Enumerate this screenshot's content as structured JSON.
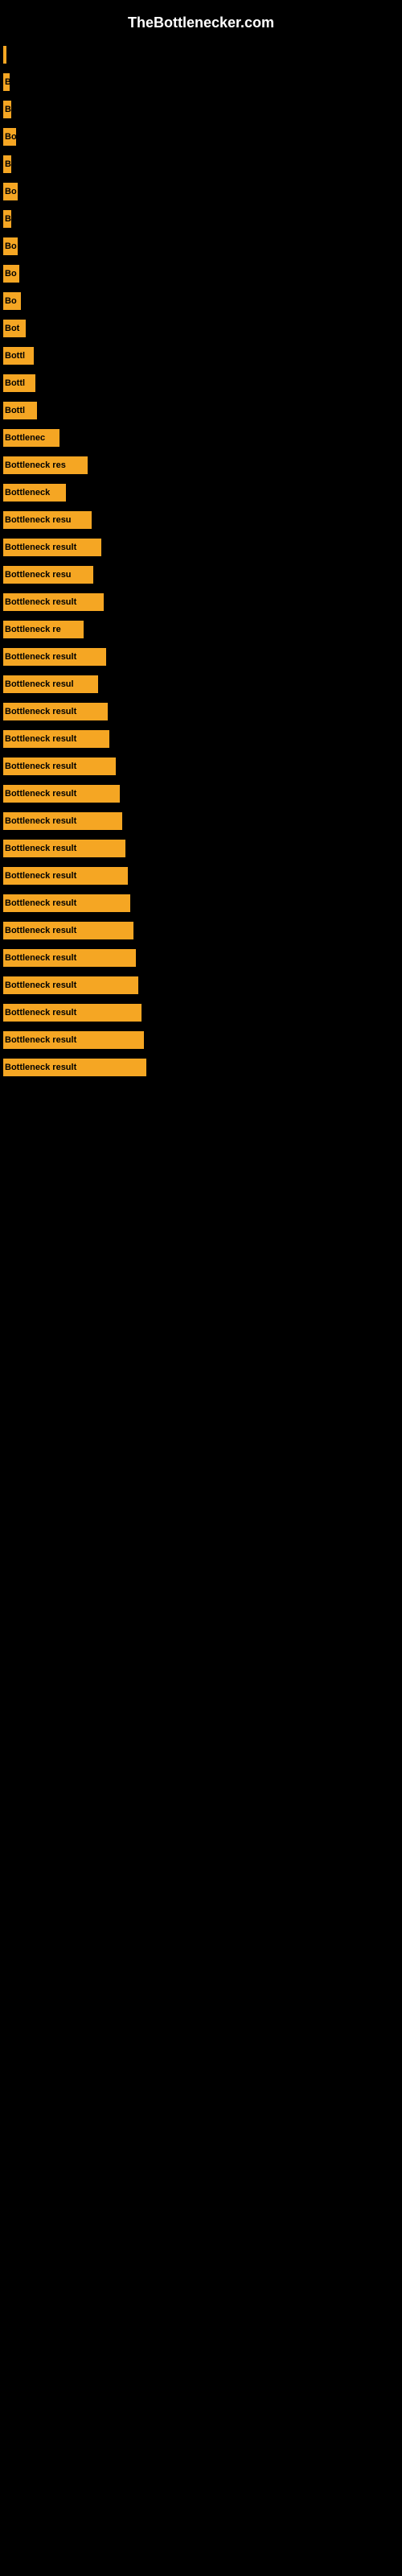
{
  "site_title": "TheBottlenecker.com",
  "bars": [
    {
      "label": "",
      "width": 4
    },
    {
      "label": "B",
      "width": 8
    },
    {
      "label": "B",
      "width": 10
    },
    {
      "label": "Bo",
      "width": 16
    },
    {
      "label": "B",
      "width": 10
    },
    {
      "label": "Bo",
      "width": 18
    },
    {
      "label": "B",
      "width": 10
    },
    {
      "label": "Bo",
      "width": 18
    },
    {
      "label": "Bo",
      "width": 20
    },
    {
      "label": "Bo",
      "width": 22
    },
    {
      "label": "Bot",
      "width": 28
    },
    {
      "label": "Bottl",
      "width": 38
    },
    {
      "label": "Bottl",
      "width": 40
    },
    {
      "label": "Bottl",
      "width": 42
    },
    {
      "label": "Bottlenec",
      "width": 70
    },
    {
      "label": "Bottleneck res",
      "width": 105
    },
    {
      "label": "Bottleneck",
      "width": 78
    },
    {
      "label": "Bottleneck resu",
      "width": 110
    },
    {
      "label": "Bottleneck result",
      "width": 122
    },
    {
      "label": "Bottleneck resu",
      "width": 112
    },
    {
      "label": "Bottleneck result",
      "width": 125
    },
    {
      "label": "Bottleneck re",
      "width": 100
    },
    {
      "label": "Bottleneck result",
      "width": 128
    },
    {
      "label": "Bottleneck resul",
      "width": 118
    },
    {
      "label": "Bottleneck result",
      "width": 130
    },
    {
      "label": "Bottleneck result",
      "width": 132
    },
    {
      "label": "Bottleneck result",
      "width": 140
    },
    {
      "label": "Bottleneck result",
      "width": 145
    },
    {
      "label": "Bottleneck result",
      "width": 148
    },
    {
      "label": "Bottleneck result",
      "width": 152
    },
    {
      "label": "Bottleneck result",
      "width": 155
    },
    {
      "label": "Bottleneck result",
      "width": 158
    },
    {
      "label": "Bottleneck result",
      "width": 162
    },
    {
      "label": "Bottleneck result",
      "width": 165
    },
    {
      "label": "Bottleneck result",
      "width": 168
    },
    {
      "label": "Bottleneck result",
      "width": 172
    },
    {
      "label": "Bottleneck result",
      "width": 175
    },
    {
      "label": "Bottleneck result",
      "width": 178
    }
  ]
}
